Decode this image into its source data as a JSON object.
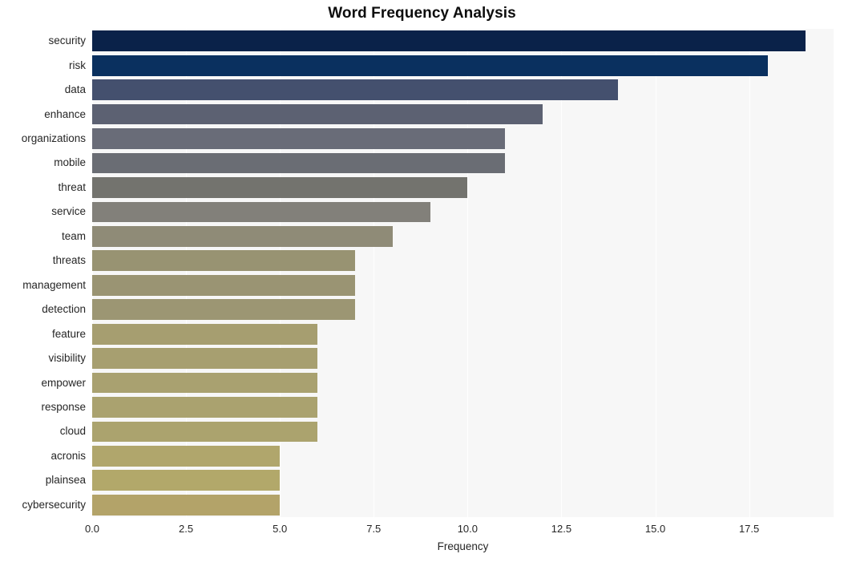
{
  "chart_data": {
    "type": "bar",
    "orientation": "horizontal",
    "title": "Word Frequency Analysis",
    "xlabel": "Frequency",
    "ylabel": "",
    "categories": [
      "security",
      "risk",
      "data",
      "enhance",
      "organizations",
      "mobile",
      "threat",
      "service",
      "team",
      "threats",
      "management",
      "detection",
      "feature",
      "visibility",
      "empower",
      "response",
      "cloud",
      "acronis",
      "plainsea",
      "cybersecurity"
    ],
    "values": [
      19,
      18,
      14,
      12,
      11,
      11,
      10,
      9,
      8,
      7,
      7,
      7,
      6,
      6,
      6,
      6,
      6,
      5,
      5,
      5
    ],
    "xlim": [
      0,
      19.75
    ],
    "ylim": [
      0,
      20
    ],
    "xticks": [
      "0.0",
      "2.5",
      "5.0",
      "7.5",
      "10.0",
      "12.5",
      "15.0",
      "17.5"
    ],
    "xtick_values": [
      0,
      2.5,
      5,
      7.5,
      10,
      12.5,
      15,
      17.5
    ],
    "grid": true,
    "grid_axis": "x",
    "legend": "none",
    "bar_colors": [
      "#0a2249",
      "#0a305f",
      "#44506e",
      "#5c6172",
      "#696c78",
      "#6a6d74",
      "#73736e",
      "#82807a",
      "#8f8b77",
      "#989372",
      "#9a9473",
      "#9c9673",
      "#a69e70",
      "#a79f70",
      "#a9a170",
      "#aaa26f",
      "#aba36e",
      "#b0a66c",
      "#b2a86a",
      "#b3a369"
    ],
    "plot_background": "#f7f7f7",
    "grid_color": "#ffffff",
    "figure_background": "#ffffff",
    "text_color": "#262626"
  }
}
